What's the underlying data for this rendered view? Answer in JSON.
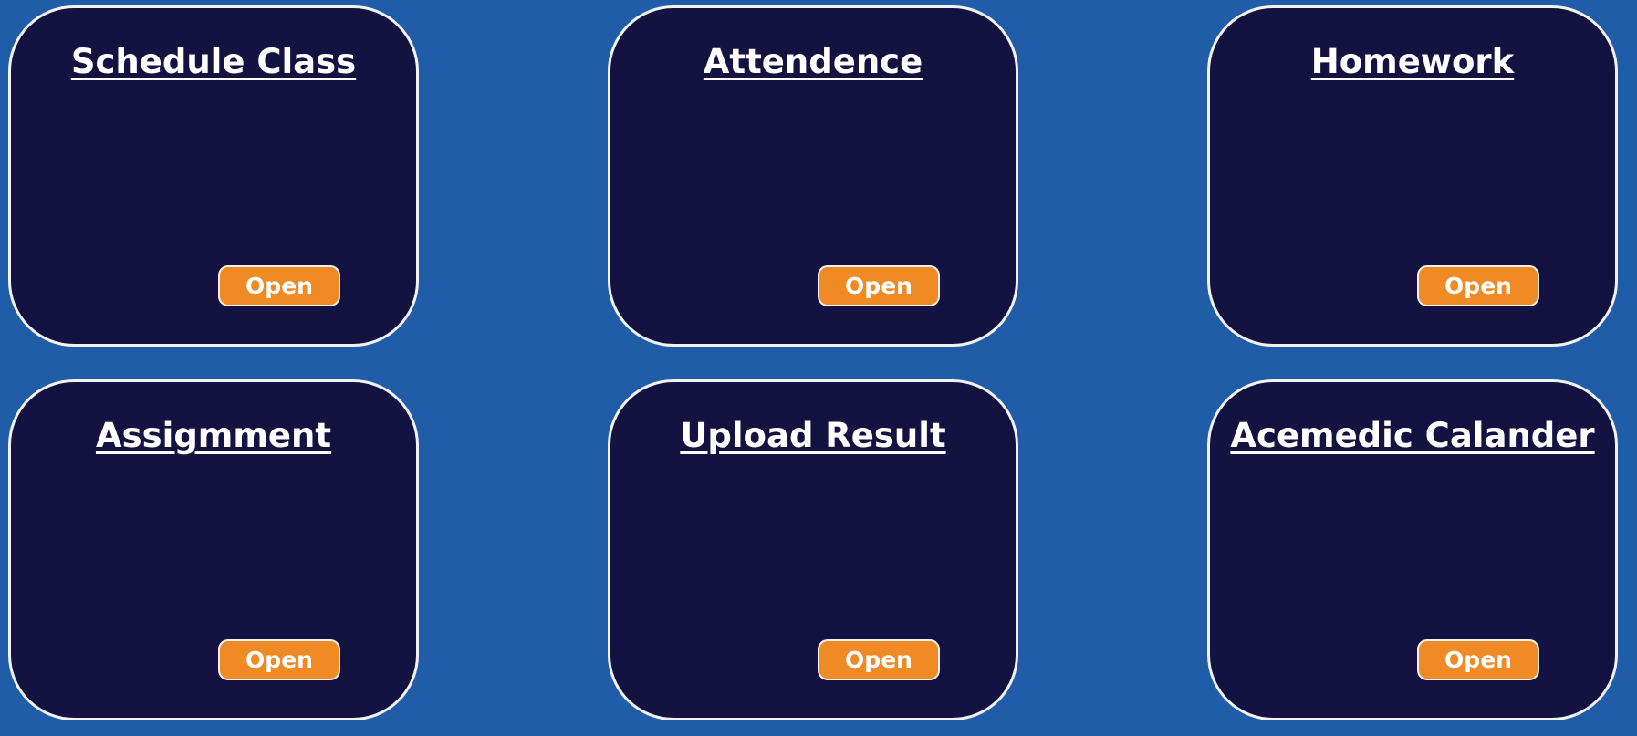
{
  "cards": [
    {
      "title": "Schedule Class",
      "button_label": "Open"
    },
    {
      "title": "Attendence",
      "button_label": "Open"
    },
    {
      "title": "Homework",
      "button_label": "Open"
    },
    {
      "title": "Assigmment",
      "button_label": "Open"
    },
    {
      "title": "Upload Result",
      "button_label": "Open"
    },
    {
      "title": "Acemedic Calander",
      "button_label": "Open"
    }
  ],
  "colors": {
    "background": "#205ca8",
    "card_background": "#131240",
    "card_border": "#f2f2f2",
    "button_background": "#f08a24",
    "text": "#ffffff"
  }
}
